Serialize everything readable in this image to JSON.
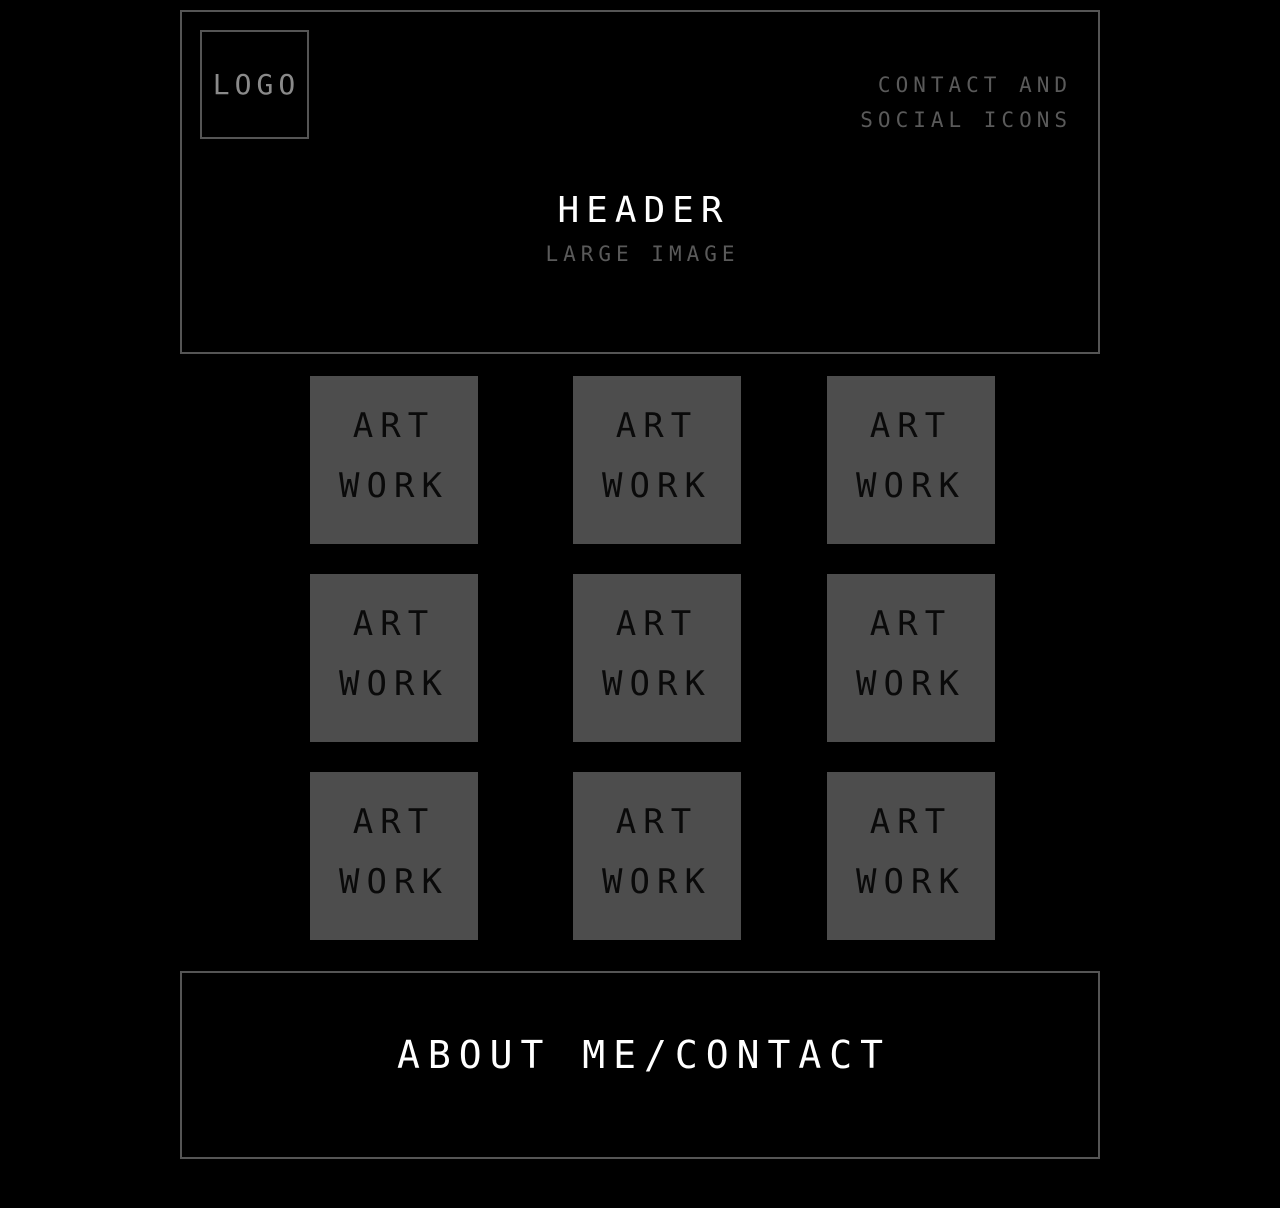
{
  "header": {
    "logo": "LOGO",
    "contact_line_1": "CONTACT AND",
    "contact_line_2": "SOCIAL ICONS",
    "title": "HEADER",
    "subtitle": "LARGE IMAGE"
  },
  "gallery": {
    "tiles": [
      {
        "line1": "ART",
        "line2": "WORK"
      },
      {
        "line1": "ART",
        "line2": "WORK"
      },
      {
        "line1": "ART",
        "line2": "WORK"
      },
      {
        "line1": "ART",
        "line2": "WORK"
      },
      {
        "line1": "ART",
        "line2": "WORK"
      },
      {
        "line1": "ART",
        "line2": "WORK"
      },
      {
        "line1": "ART",
        "line2": "WORK"
      },
      {
        "line1": "ART",
        "line2": "WORK"
      },
      {
        "line1": "ART",
        "line2": "WORK"
      }
    ]
  },
  "footer": {
    "title": "ABOUT ME/CONTACT"
  },
  "colors": {
    "background": "#000000",
    "border": "#555555",
    "tile": "#4d4d4d",
    "muted_text": "#5a5a5a",
    "heading_text": "#ffffff"
  }
}
